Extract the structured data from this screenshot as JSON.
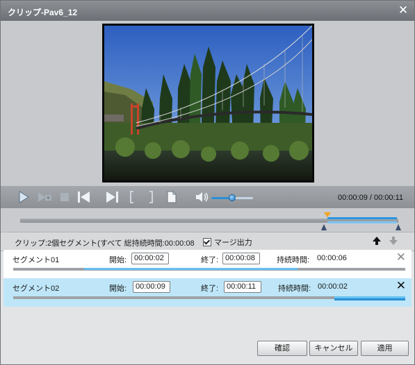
{
  "window": {
    "title": "クリップ-Pav6_12",
    "close_icon": "close-icon"
  },
  "player": {
    "timecode": "00:00:09 / 00:00:11",
    "volume_level": 0.5,
    "icons": [
      "play-icon",
      "snapshot-icon",
      "stop-icon",
      "previous-icon",
      "next-icon",
      "mark-in-icon",
      "mark-out-icon",
      "file-icon",
      "volume-icon"
    ]
  },
  "timeline": {
    "position_fraction": 0.82,
    "selection_start_fraction": 0.82,
    "selection_end_fraction": 1.0
  },
  "info": {
    "summary": "クリップ:2個セグメント(すべて  総持続時間:00:00:08",
    "merge_label": "マージ出力",
    "merge_checked": true
  },
  "segment_labels": {
    "start": "開始:",
    "end": "終了:",
    "duration": "持続時間:"
  },
  "segments": [
    {
      "name": "セグメント01",
      "start": "00:00:02",
      "end": "00:00:08",
      "duration": "00:00:06",
      "selected": false
    },
    {
      "name": "セグメント02",
      "start": "00:00:09",
      "end": "00:00:11",
      "duration": "00:00:02",
      "selected": true
    }
  ],
  "buttons": {
    "confirm": "確認",
    "cancel": "キャンセル",
    "apply": "適用"
  },
  "colors": {
    "accent": "#2a8fd6",
    "selected_row": "#bee6f8",
    "marker": "#f2a41f"
  }
}
